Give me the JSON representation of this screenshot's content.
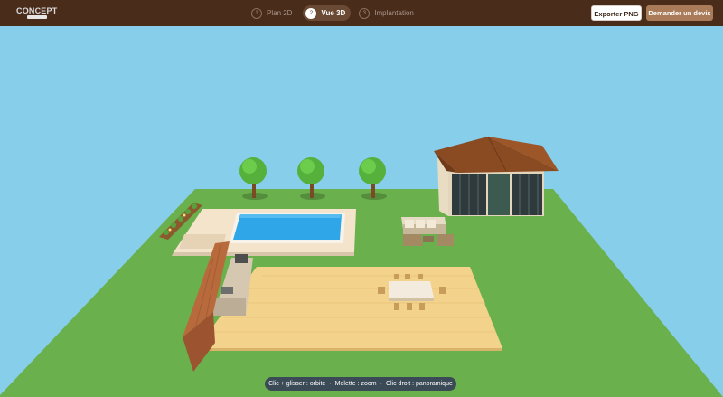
{
  "header": {
    "logo_text": "CONCEPT",
    "steps": [
      {
        "number": "1",
        "label": "Plan 2D",
        "active": false
      },
      {
        "number": "2",
        "label": "Vue 3D",
        "active": true
      },
      {
        "number": "3",
        "label": "Implantation",
        "active": false
      }
    ],
    "export_label": "Exporter PNG",
    "quote_label": "Demander un devis"
  },
  "scene": {
    "sky_color": "#87ceeb",
    "grass_color": "#6ab04c",
    "pool_water_color": "#2fa6e8",
    "deck_color": "#f3d38c",
    "roof_color": "#8a4a22"
  },
  "hint": {
    "items": [
      "Clic + glisser : orbite",
      "Molette : zoom",
      "Clic droit : panoramique"
    ],
    "separator": "·"
  }
}
